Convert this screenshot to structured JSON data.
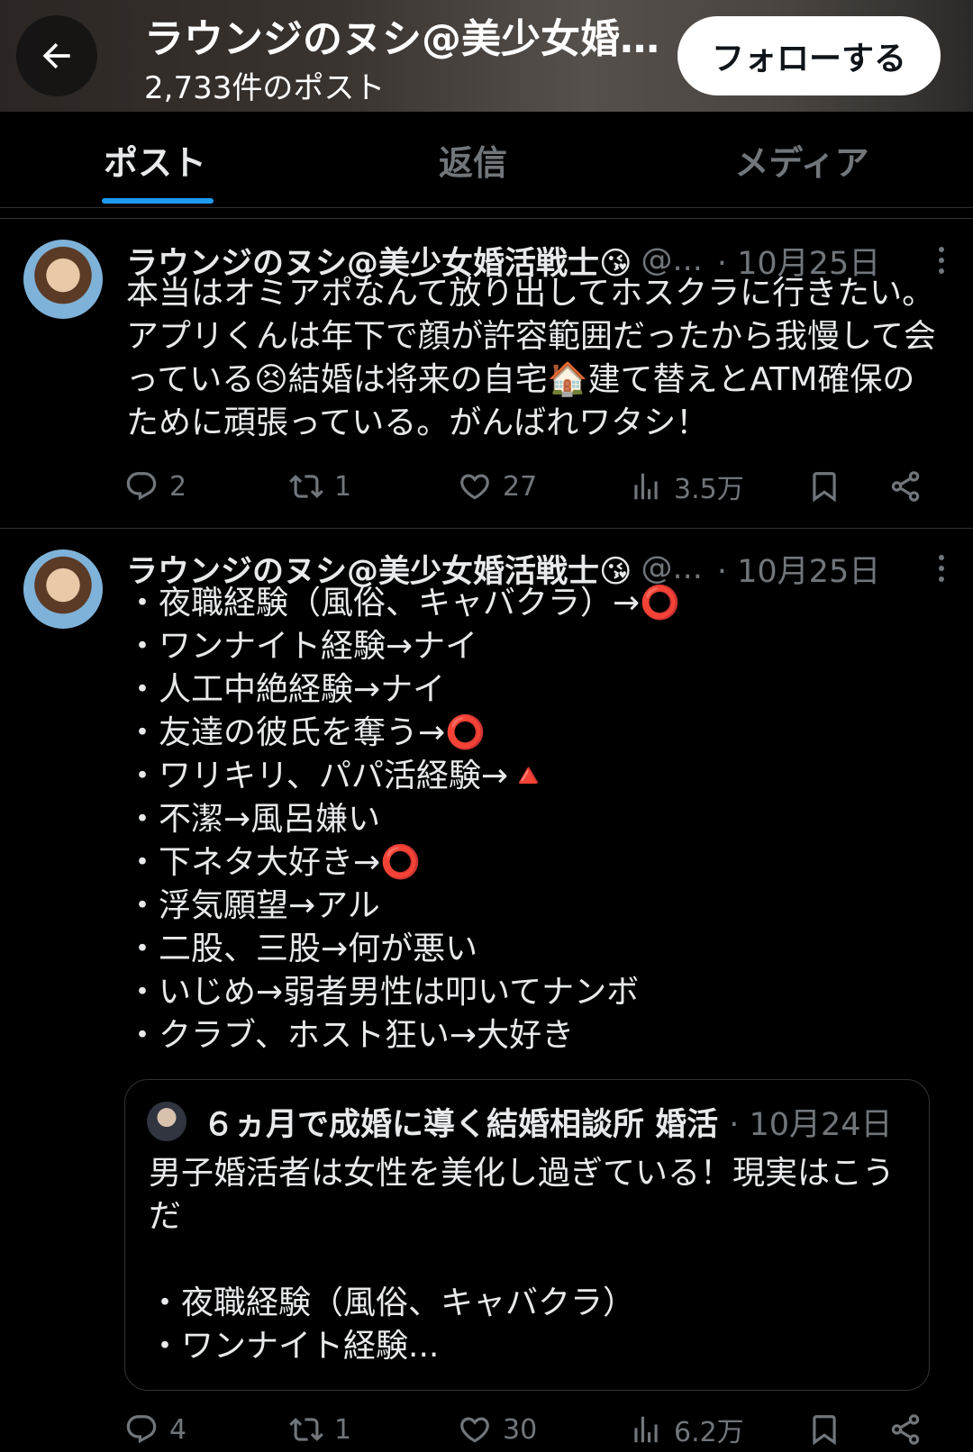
{
  "header": {
    "title": "ラウンジのヌシ@美少女婚活戦士😘",
    "post_count": "2,733件のポスト",
    "follow_label": "フォローする"
  },
  "tabs": [
    {
      "label": "ポスト",
      "active": true
    },
    {
      "label": "返信",
      "active": false
    },
    {
      "label": "メディア",
      "active": false
    }
  ],
  "posts": [
    {
      "name": "ラウンジのヌシ@美少女婚活戦士😘",
      "handle": "@...",
      "date": "· 10月25日",
      "text": "本当はオミアポなんて放り出してホスクラに行きたい。アプリくんは年下で顔が許容範囲だったから我慢して会っている😣結婚は将来の自宅🏠建て替えとATM確保のために頑張っている。がんばれワタシ！",
      "replies": "2",
      "reposts": "1",
      "likes": "27",
      "views": "3.5万"
    },
    {
      "name": "ラウンジのヌシ@美少女婚活戦士😘",
      "handle": "@...",
      "date": "· 10月25日",
      "text": "・夜職経験（風俗、キャバクラ）→⭕\n・ワンナイト経験→ナイ\n・人工中絶経験→ナイ\n・友達の彼氏を奪う→⭕\n・ワリキリ、パパ活経験→🔺\n・不潔→風呂嫌い\n・下ネタ大好き→⭕\n・浮気願望→アル\n・二股、三股→何が悪い\n・いじめ→弱者男性は叩いてナンボ\n・クラブ、ホスト狂い→大好き",
      "quote": {
        "name": "６ヵ月で成婚に導く結婚相談所 婚活",
        "date": "· 10月24日",
        "text": "男子婚活者は女性を美化し過ぎている！現実はこうだ\n\n・夜職経験（風俗、キャバクラ）\n・ワンナイト経験..."
      },
      "replies": "4",
      "reposts": "1",
      "likes": "30",
      "views": "6.2万"
    }
  ],
  "colors": {
    "accent": "#1d9bf0",
    "muted": "#71767b",
    "text": "#e7e9ea",
    "background": "#000000",
    "border": "#2f3336"
  }
}
